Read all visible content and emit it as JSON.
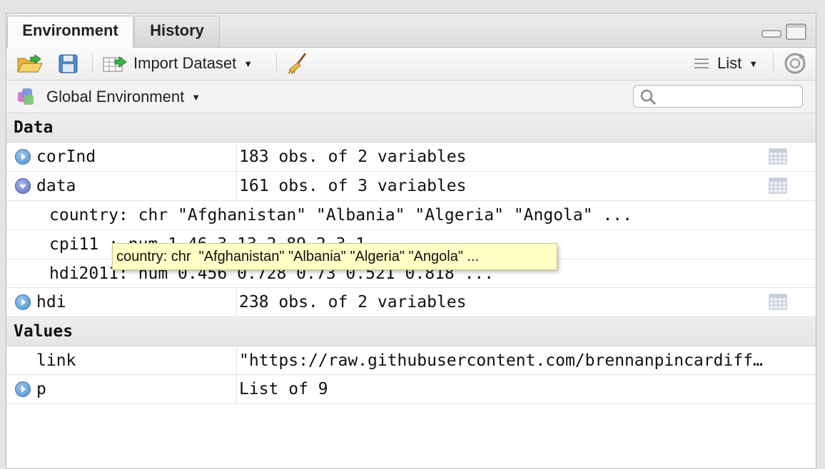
{
  "tabs": [
    {
      "label": "Environment",
      "active": true
    },
    {
      "label": "History",
      "active": false
    }
  ],
  "toolbar": {
    "import_label": "Import Dataset",
    "view_label": "List"
  },
  "env": {
    "scope_label": "Global Environment",
    "search_placeholder": ""
  },
  "sections": {
    "data": "Data",
    "values": "Values"
  },
  "rows": {
    "corInd": {
      "name": "corInd",
      "value": "183 obs. of 2 variables"
    },
    "data": {
      "name": "data",
      "value": "161 obs. of 3 variables"
    },
    "country": {
      "text": "country: chr \"Afghanistan\" \"Albania\" \"Algeria\" \"Angola\" ..."
    },
    "cpi11": {
      "text": "cpi11 : num 1.46 3.13 2.89 2.3 1 ..."
    },
    "hdi2011": {
      "text": "hdi2011: num 0.456 0.728 0.73 0.521 0.818 ..."
    },
    "hdi": {
      "name": "hdi",
      "value": "238 obs. of 2 variables"
    },
    "link": {
      "name": "link",
      "value": "\"https://raw.githubusercontent.com/brennanpincardiff…"
    },
    "p": {
      "name": "p",
      "value": "List of 9"
    }
  },
  "tooltip": {
    "text": "country: chr  \"Afghanistan\" \"Albania\" \"Algeria\" \"Angola\" ..."
  },
  "colors": {
    "tooltip_bg": "#ffffc6",
    "expand_icon": "#4a8fd1",
    "collapse_icon": "#5a6fc8"
  }
}
